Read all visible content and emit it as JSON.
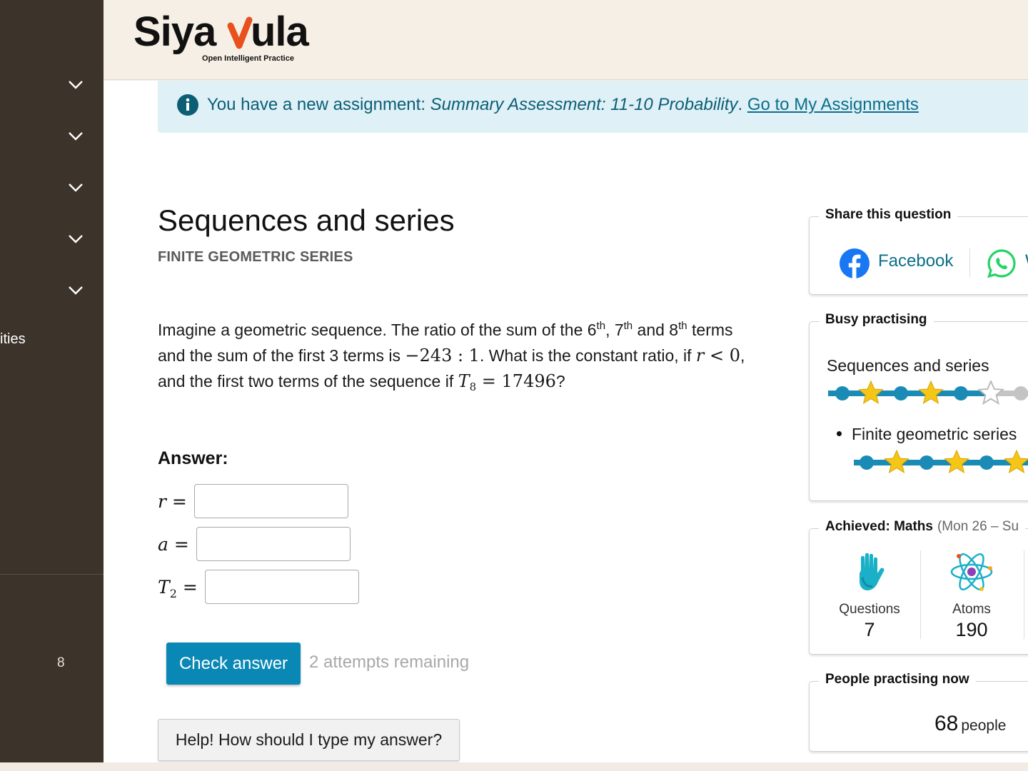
{
  "colors": {
    "sidebar": "#3c332a",
    "header": "#f6efe6",
    "accent": "#0a88b5",
    "alert_bg": "#dff0f7",
    "link": "#0b6f8a",
    "star": "#f5c518",
    "progress": "#1a8bb5"
  },
  "sidebar": {
    "partial_label": "ities",
    "number": "8",
    "icons": [
      "chevron-down-icon",
      "chevron-down-icon",
      "chevron-down-icon",
      "chevron-down-icon",
      "chevron-down-icon"
    ]
  },
  "header": {
    "logo_text": "Siyavula",
    "logo_tagline": "Open Intelligent Practice"
  },
  "alert": {
    "icon": "info-icon",
    "prefix": "You have a new assignment: ",
    "assignment": "Summary Assessment: 11-10 Probability",
    "suffix": ". ",
    "link": "Go to My Assignments"
  },
  "page": {
    "title": "Sequences and series",
    "subtitle": "FINITE GEOMETRIC SERIES"
  },
  "question": {
    "p1": "Imagine a geometric sequence. The ratio of the sum of the 6",
    "sup1": "th",
    "p2": ", 7",
    "sup2": "th",
    "p3": " and 8",
    "sup3": "th",
    "p4": " terms and the sum of the first 3 terms is ",
    "math1": "−243 : 1",
    "p5": ". What is the constant ratio, if ",
    "math2_var": "r",
    "math2_rest": " < 0",
    "p6": ", and the first two terms of the sequence if ",
    "math3_var": "T",
    "math3_sub": "8",
    "math3_rest": " = 17496",
    "p7": "?"
  },
  "answer": {
    "label": "Answer:",
    "fields": [
      {
        "var": "r",
        "sub": "",
        "value": ""
      },
      {
        "var": "a",
        "sub": "",
        "value": ""
      },
      {
        "var": "T",
        "sub": "2",
        "value": ""
      }
    ],
    "equals": " =",
    "check_label": "Check answer",
    "attempts": "2 attempts remaining",
    "help_label": "Help! How should I type my answer?"
  },
  "share": {
    "title": "Share this question",
    "facebook": "Facebook",
    "whatsapp_partial": "W",
    "facebook_icon": "facebook-icon",
    "whatsapp_icon": "whatsapp-icon"
  },
  "busy": {
    "title": "Busy practising",
    "topic": "Sequences and series",
    "topic_stars_filled": 2,
    "subtopic": "Finite geometric series",
    "subtopic_stars_filled": 3
  },
  "achieved": {
    "title": "Achieved: Maths",
    "range": "(Mon 26 – Su",
    "items": [
      {
        "label": "Questions",
        "value": "7",
        "icon": "hand-icon"
      },
      {
        "label": "Atoms",
        "value": "190",
        "icon": "atom-icon"
      }
    ]
  },
  "people": {
    "title": "People practising now",
    "count": "68",
    "unit": "people"
  }
}
